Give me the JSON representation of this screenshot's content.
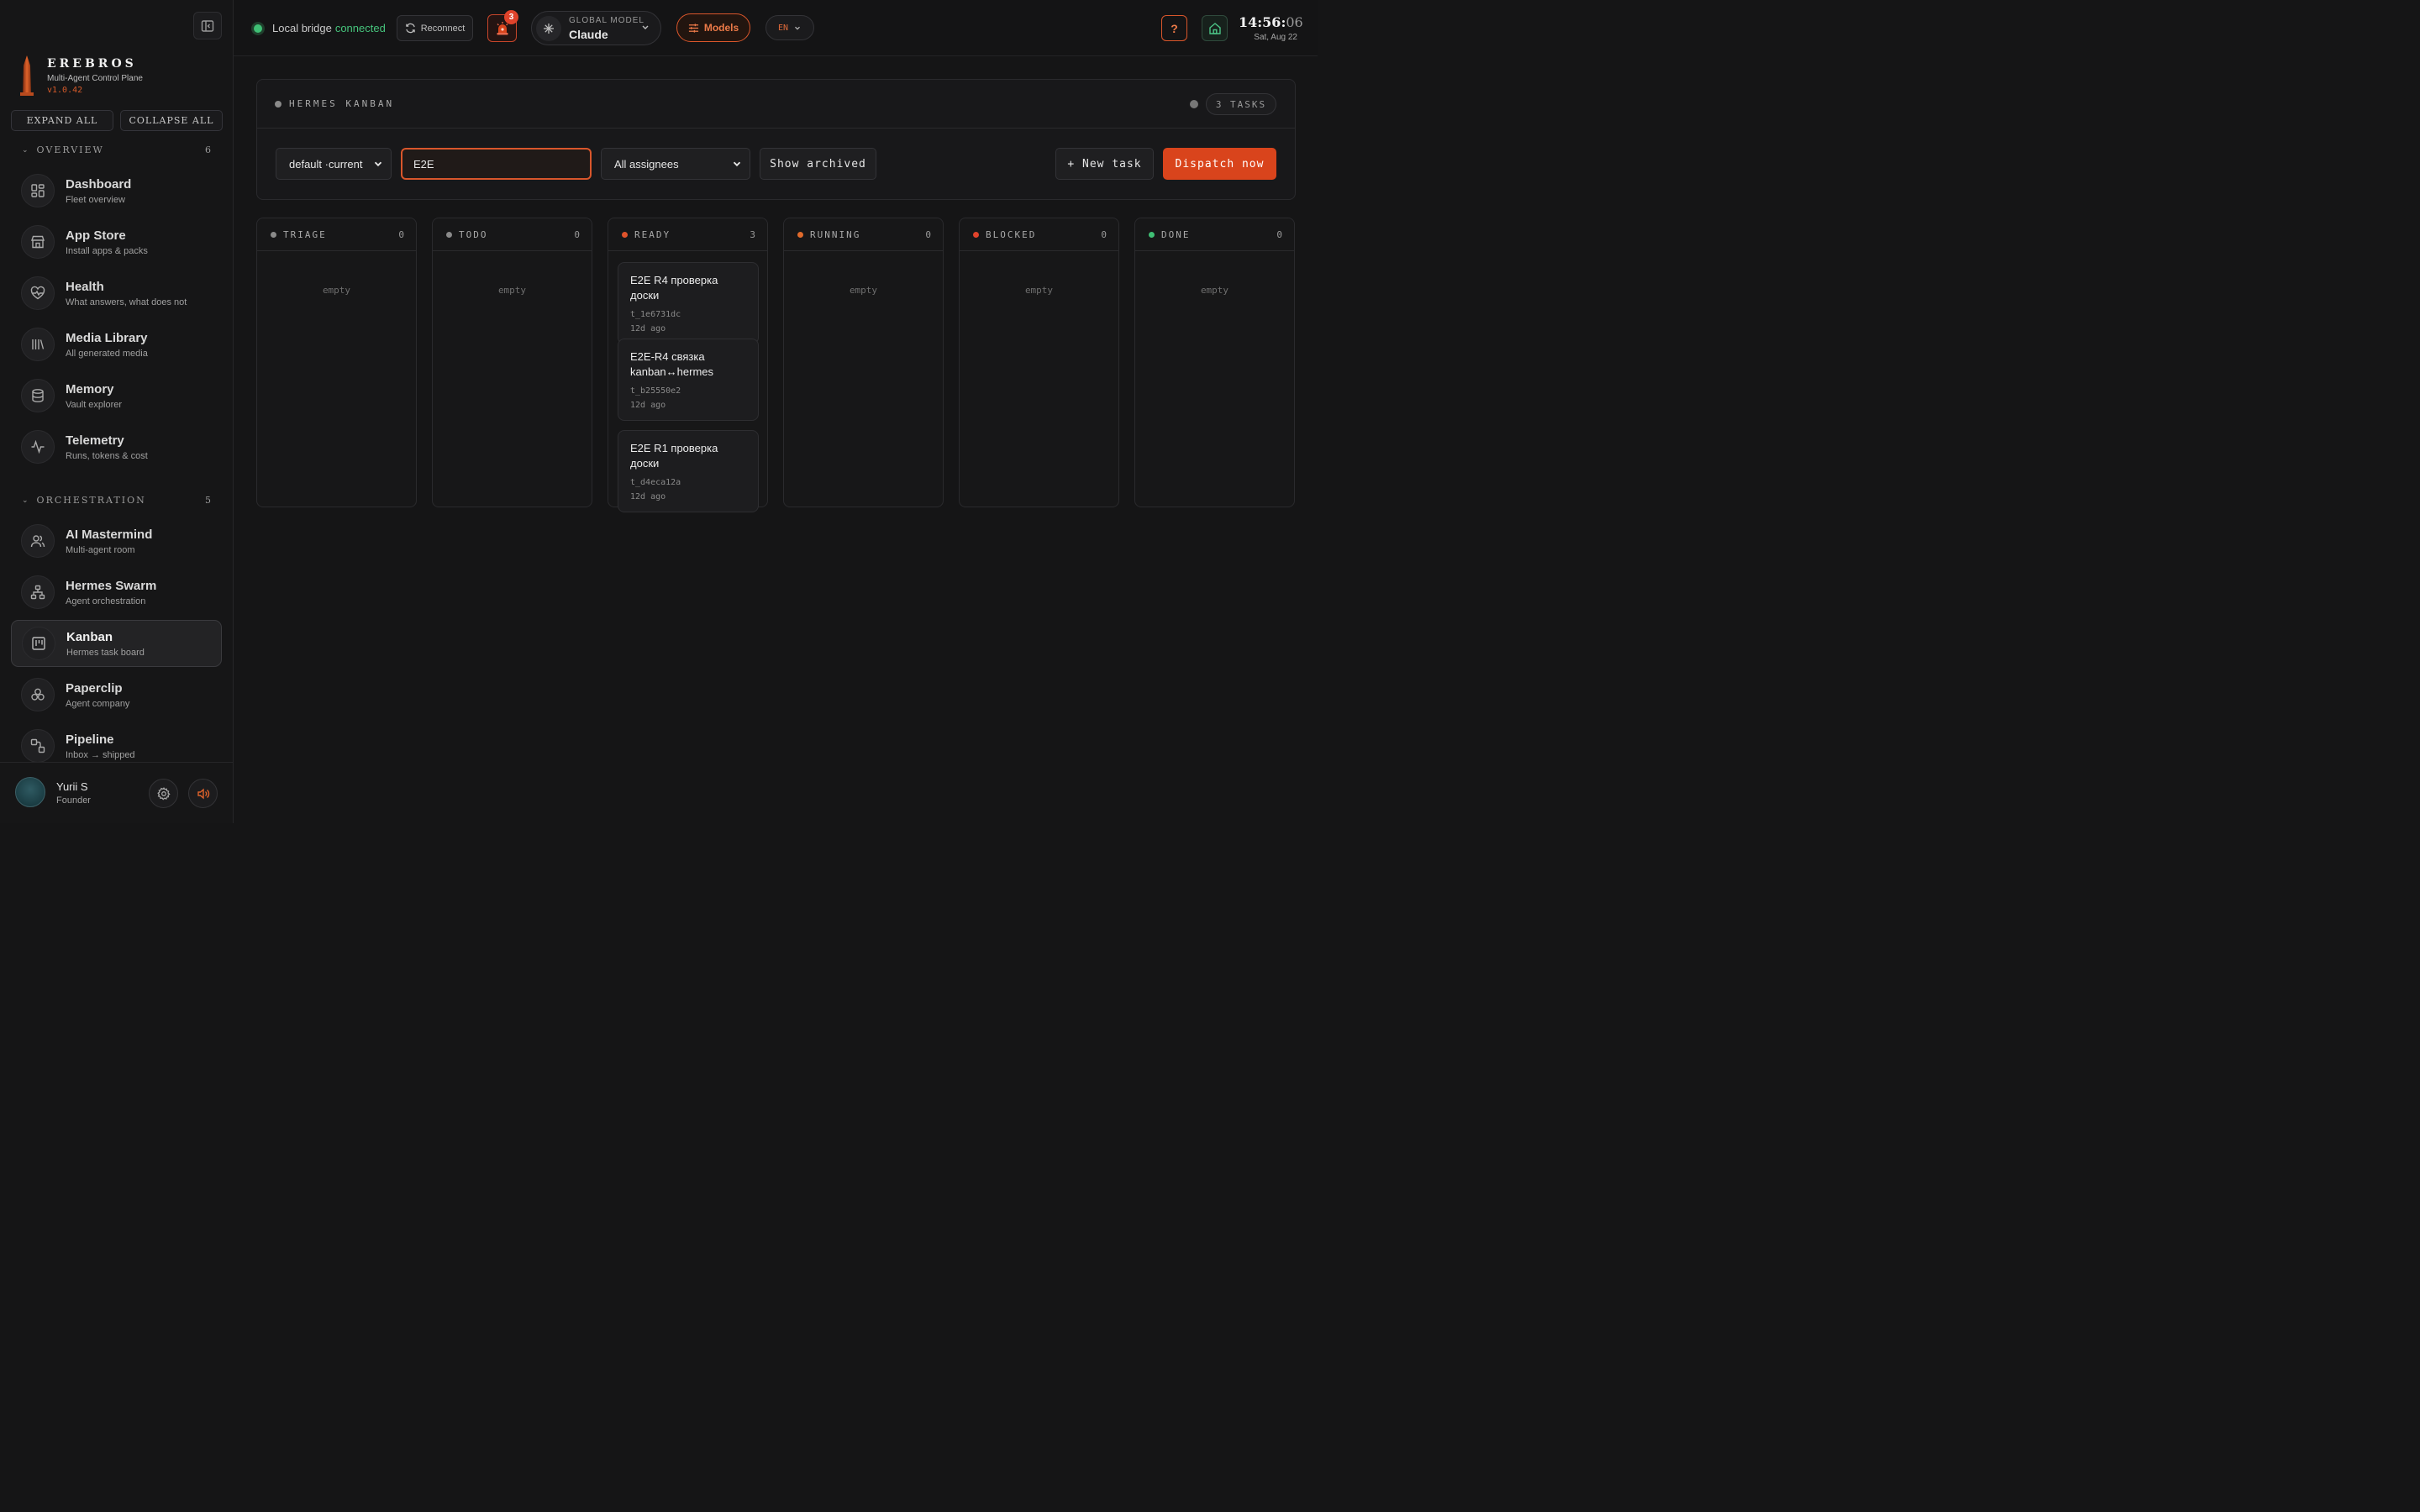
{
  "brand": {
    "name": "EREBROS",
    "subtitle": "Multi-Agent Control Plane",
    "version": "v1.0.42"
  },
  "sidebar": {
    "expand_all": "EXPAND ALL",
    "collapse_all": "COLLAPSE ALL",
    "sections": [
      {
        "label": "OVERVIEW",
        "count": "6",
        "items": [
          {
            "title": "Dashboard",
            "sub": "Fleet overview",
            "icon": "dashboard-icon"
          },
          {
            "title": "App Store",
            "sub": "Install apps & packs",
            "icon": "store-icon"
          },
          {
            "title": "Health",
            "sub": "What answers, what does not",
            "icon": "heart-pulse-icon"
          },
          {
            "title": "Media Library",
            "sub": "All generated media",
            "icon": "library-icon"
          },
          {
            "title": "Memory",
            "sub": "Vault explorer",
            "icon": "database-icon"
          },
          {
            "title": "Telemetry",
            "sub": "Runs, tokens & cost",
            "icon": "activity-icon"
          }
        ]
      },
      {
        "label": "ORCHESTRATION",
        "count": "5",
        "items": [
          {
            "title": "AI Mastermind",
            "sub": "Multi-agent room",
            "icon": "users-icon"
          },
          {
            "title": "Hermes Swarm",
            "sub": "Agent orchestration",
            "icon": "network-icon"
          },
          {
            "title": "Kanban",
            "sub": "Hermes task board",
            "icon": "kanban-icon",
            "active": true
          },
          {
            "title": "Paperclip",
            "sub": "Agent company",
            "icon": "circles-icon"
          },
          {
            "title": "Pipeline",
            "sub": "Inbox → shipped",
            "icon": "pipeline-icon"
          }
        ]
      }
    ],
    "user": {
      "name": "Yurii S",
      "role": "Founder"
    }
  },
  "topbar": {
    "bridge_label": "Local bridge",
    "bridge_status": "connected",
    "reconnect": "Reconnect",
    "alerts_count": "3",
    "model_label": "GLOBAL MODEL",
    "model_value": "Claude",
    "models_btn": "Models",
    "lang": "EN",
    "help": "?",
    "clock_hm": "14:56:",
    "clock_s": "06",
    "clock_date": "Sat, Aug 22"
  },
  "board": {
    "title": "HERMES KANBAN",
    "tasks_count": "3 TASKS",
    "board_select": "default ·current",
    "search_value": "E2E",
    "assignees_select": "All assignees",
    "show_archived": "Show archived",
    "new_task": "+ New task",
    "dispatch": "Dispatch now",
    "empty_label": "empty",
    "columns": [
      {
        "name": "TRIAGE",
        "count": "0",
        "dot": "#8a8a8a",
        "cards": []
      },
      {
        "name": "TODO",
        "count": "0",
        "dot": "#8a8a8a",
        "cards": []
      },
      {
        "name": "READY",
        "count": "3",
        "dot": "#e0532b",
        "cards": [
          {
            "title": "E2E R4 проверка доски",
            "id": "t_1e6731dc",
            "age": "12d ago"
          },
          {
            "title": "E2E-R4 связка kanban↔hermes",
            "id": "t_b25550e2",
            "age": "12d ago"
          },
          {
            "title": "E2E R1 проверка доски",
            "id": "t_d4eca12a",
            "age": "12d ago"
          }
        ]
      },
      {
        "name": "RUNNING",
        "count": "0",
        "dot": "#e06a2b",
        "cards": []
      },
      {
        "name": "BLOCKED",
        "count": "0",
        "dot": "#e0432b",
        "cards": []
      },
      {
        "name": "DONE",
        "count": "0",
        "dot": "#3fbf74",
        "cards": []
      }
    ]
  },
  "colors": {
    "accent": "#d9562b",
    "success": "#3fbf74"
  }
}
